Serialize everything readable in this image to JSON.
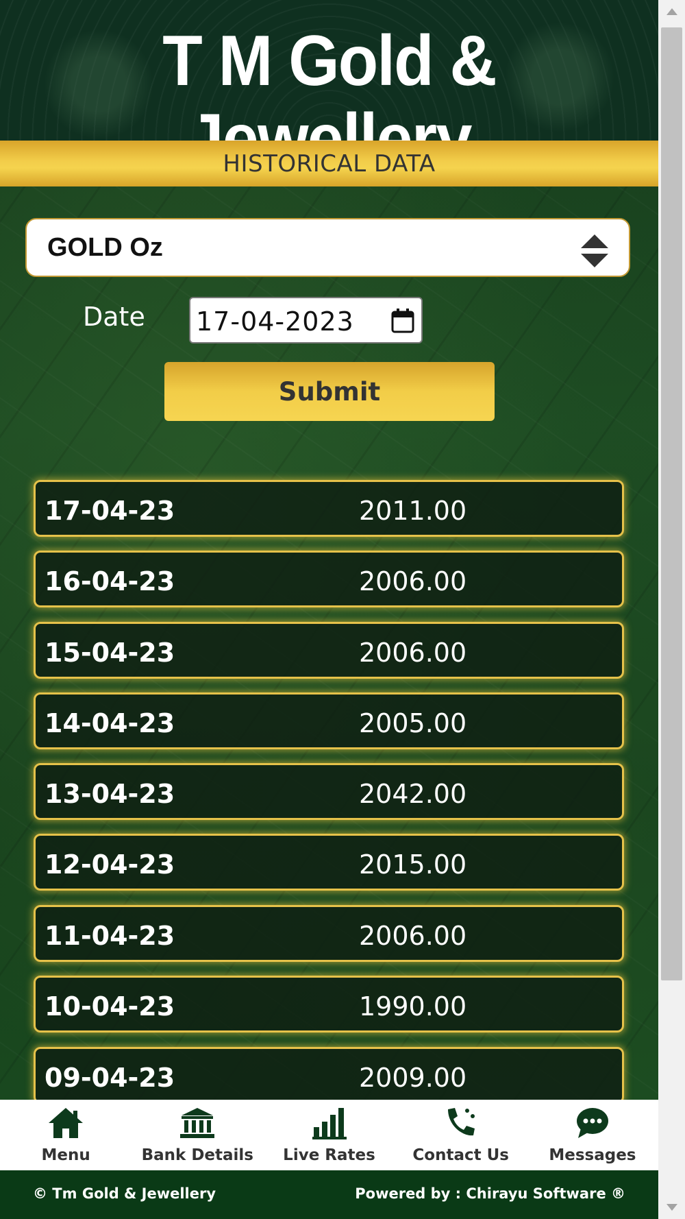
{
  "header": {
    "brand": "T M Gold & Jewellery"
  },
  "band": {
    "title": "HISTORICAL DATA"
  },
  "form": {
    "product_selected": "GOLD Oz",
    "date_label": "Date",
    "date_value": "17-04-2023",
    "submit_label": "Submit"
  },
  "rows": [
    {
      "date": "17-04-23",
      "price": "2011.00"
    },
    {
      "date": "16-04-23",
      "price": "2006.00"
    },
    {
      "date": "15-04-23",
      "price": "2006.00"
    },
    {
      "date": "14-04-23",
      "price": "2005.00"
    },
    {
      "date": "13-04-23",
      "price": "2042.00"
    },
    {
      "date": "12-04-23",
      "price": "2015.00"
    },
    {
      "date": "11-04-23",
      "price": "2006.00"
    },
    {
      "date": "10-04-23",
      "price": "1990.00"
    },
    {
      "date": "09-04-23",
      "price": "2009.00"
    }
  ],
  "nav": {
    "items": [
      {
        "label": "Menu",
        "icon": "home-icon"
      },
      {
        "label": "Bank Details",
        "icon": "bank-icon"
      },
      {
        "label": "Live Rates",
        "icon": "bar-chart-icon"
      },
      {
        "label": "Contact Us",
        "icon": "phone-icon"
      },
      {
        "label": "Messages",
        "icon": "chat-icon"
      }
    ]
  },
  "footer": {
    "copyright": "© Tm Gold & Jewellery",
    "powered_by": "Powered by : Chirayu Software ®"
  },
  "colors": {
    "gold": "#f2cd4a",
    "dark_green": "#0a3a16",
    "row_border": "#e6c24a"
  }
}
